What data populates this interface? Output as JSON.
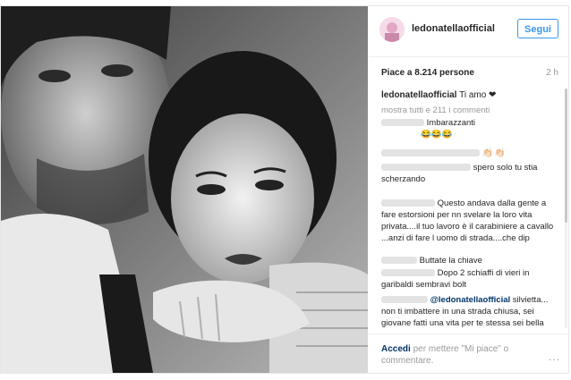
{
  "header": {
    "username": "ledonatellaofficial",
    "follow_label": "Segui"
  },
  "post": {
    "likes_text": "Piace a 8.214 persone",
    "time": "2 h",
    "caption_user": "ledonatellaofficial",
    "caption_text": "Ti amo ❤",
    "show_all_comments": "mostra tutti e 211 i commenti"
  },
  "comments": [
    {
      "text": "Imbarazzanti",
      "emoji": "😂😂😂"
    },
    {
      "text": "👏🏻👏🏻"
    },
    {
      "text": "spero solo tu stia scherzando"
    },
    {
      "text": "Questo andava dalla gente a fare estorsioni per nn svelare la loro vita privata....il tuo lavoro è il carabiniere a cavallo ...anzi di fare l uomo di strada....che dip"
    },
    {
      "text": "Buttate la chiave"
    },
    {
      "text": "Dopo 2 schiaffi di vieri in garibaldi sembravi bolt"
    },
    {
      "mention": "@ledonatellaofficial",
      "text": "silvietta... non ti imbattere in una strada chiusa, sei giovane fatti una vita per te stessa sei bella brava ti abbiamo conosciuto, esci e"
    }
  ],
  "footer": {
    "login_label": "Accedi",
    "rest_text": "per mettere \"Mi piace\" o commentare.",
    "more_label": "..."
  },
  "colors": {
    "link": "#003569",
    "accent": "#3897f0"
  }
}
